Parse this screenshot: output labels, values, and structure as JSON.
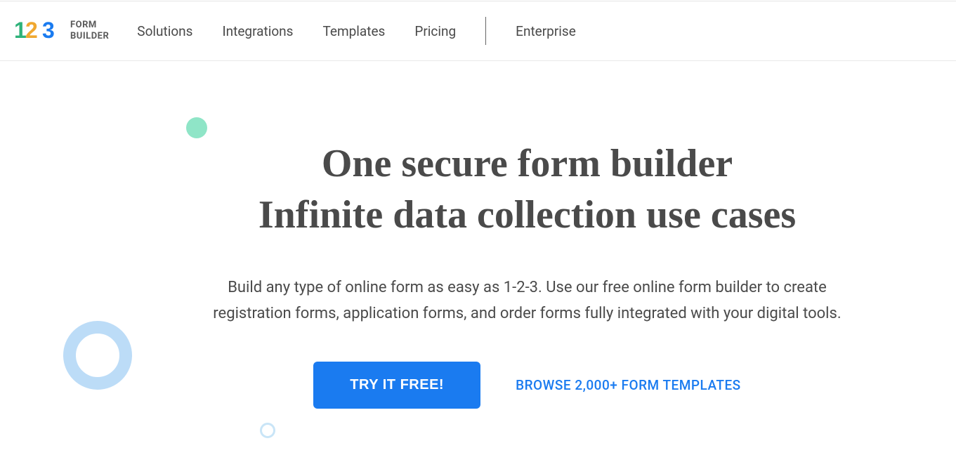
{
  "logo": {
    "text_line1": "FORM",
    "text_line2": "BUILDER"
  },
  "nav": {
    "items": [
      "Solutions",
      "Integrations",
      "Templates",
      "Pricing"
    ],
    "enterprise": "Enterprise"
  },
  "hero": {
    "headline_line1": "One secure form builder",
    "headline_line2": "Infinite data collection use cases",
    "subhead_line1": "Build any type of online form as easy as 1-2-3. Use our free online form builder to create",
    "subhead_line2": "registration forms, application forms, and order forms fully integrated with your digital tools.",
    "cta_primary": "TRY IT FREE!",
    "cta_browse": "BROWSE 2,000+ FORM TEMPLATES"
  },
  "colors": {
    "primary_blue": "#1a7bf0",
    "text_dark": "#4a4a4a",
    "teal_dot": "#8fe5c7",
    "blue_ring": "#bcdcf7"
  }
}
